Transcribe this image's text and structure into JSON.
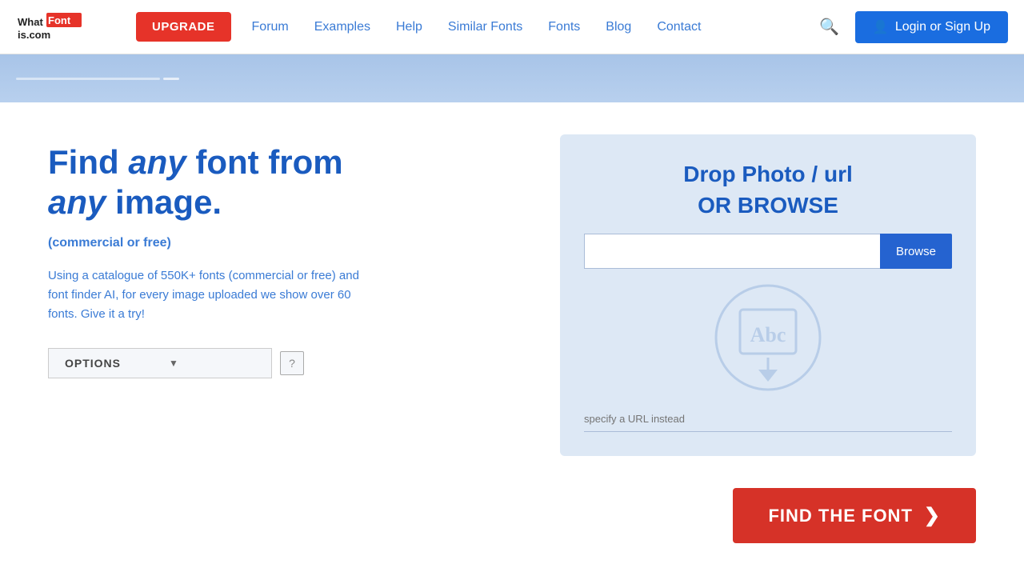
{
  "header": {
    "logo_text": "WhatFont Is.com",
    "upgrade_label": "UPGRADE",
    "nav_items": [
      {
        "label": "Forum",
        "id": "forum"
      },
      {
        "label": "Examples",
        "id": "examples"
      },
      {
        "label": "Help",
        "id": "help"
      },
      {
        "label": "Similar Fonts",
        "id": "similar-fonts"
      },
      {
        "label": "Fonts",
        "id": "fonts"
      },
      {
        "label": "Blog",
        "id": "blog"
      },
      {
        "label": "Contact",
        "id": "contact"
      }
    ],
    "login_label": "Login or Sign Up"
  },
  "main": {
    "headline_part1": "Find ",
    "headline_any1": "any",
    "headline_part2": " font from ",
    "headline_any2": "any",
    "headline_part3": " image.",
    "subheadline": "(commercial or free)",
    "description": "Using a catalogue of 550K+ fonts (commercial or free) and font finder AI, for every image uploaded we show over 60 fonts. Give it a try!",
    "options_label": "OPTIONS",
    "help_label": "?",
    "drop_title_line1": "Drop Photo / url",
    "drop_title_line2": "OR BROWSE",
    "browse_placeholder": "",
    "browse_btn_label": "Browse",
    "url_instead_placeholder": "specify a URL instead",
    "find_font_btn_label": "FIND THE FONT",
    "find_font_arrow": "❯"
  },
  "colors": {
    "primary_blue": "#1a5bbf",
    "nav_blue": "#3a7bd5",
    "upgrade_red": "#e63329",
    "login_blue": "#1a6de0",
    "browse_blue": "#2563d0",
    "find_red": "#d63228",
    "drop_bg": "#dde8f5",
    "drop_icon_color": "#b8cde8"
  }
}
